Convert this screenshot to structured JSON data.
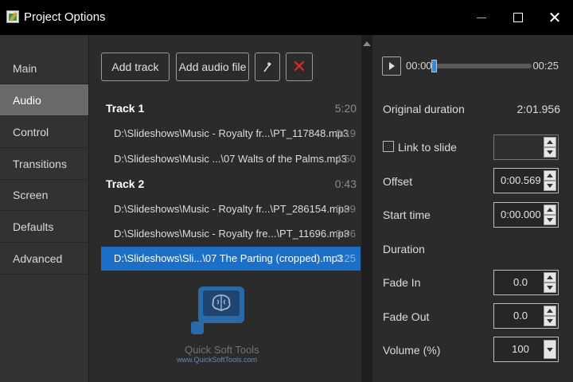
{
  "window": {
    "title": "Project Options",
    "minimize_icon": "minimize-icon",
    "maximize_icon": "maximize-icon",
    "close_glyph": "✕"
  },
  "sidebar": {
    "items": [
      {
        "label": "Main",
        "active": false
      },
      {
        "label": "Audio",
        "active": true
      },
      {
        "label": "Control",
        "active": false
      },
      {
        "label": "Transitions",
        "active": false
      },
      {
        "label": "Screen",
        "active": false
      },
      {
        "label": "Defaults",
        "active": false
      },
      {
        "label": "Advanced",
        "active": false
      }
    ]
  },
  "toolbar": {
    "add_track_label": "Add track",
    "add_audio_label": "Add audio file",
    "tool_icon": "wrench-icon",
    "delete_glyph": "✕"
  },
  "tracks": [
    {
      "name": "Track 1",
      "duration": "5:20",
      "files": [
        {
          "path": "D:\\Slideshows\\Music - Royalty fr...\\PT_117848.mp3",
          "duration": "0:19",
          "selected": false
        },
        {
          "path": "D:\\Slideshows\\Music ...\\07 Walts of the Palms.mp3",
          "duration": "4:50",
          "selected": false
        }
      ]
    },
    {
      "name": "Track 2",
      "duration": "0:43",
      "files": [
        {
          "path": "D:\\Slideshows\\Music - Royalty fr...\\PT_286154.mp3",
          "duration": "0:09",
          "selected": false
        },
        {
          "path": "D:\\Slideshows\\Music - Royalty fre...\\PT_11696.mp3",
          "duration": "0:06",
          "selected": false
        },
        {
          "path": "D:\\Slideshows\\Sli...\\07 The Parting (cropped).mp3",
          "duration": "0:25",
          "selected": true
        }
      ]
    }
  ],
  "player": {
    "current_time": "00:00",
    "end_time": "00:25",
    "progress": 0.0
  },
  "properties": {
    "original_duration_label": "Original duration",
    "original_duration_value": "2:01.956",
    "link_to_slide_label": "Link to slide",
    "link_to_slide_checked": false,
    "offset_label": "Offset",
    "offset_value": "0:00.569",
    "start_time_label": "Start time",
    "start_time_value": "0:00.000",
    "duration_label": "Duration",
    "fade_in_label": "Fade In",
    "fade_in_value": "0.0",
    "fade_out_label": "Fade Out",
    "fade_out_value": "0.0",
    "volume_label": "Volume (%)",
    "volume_value": "100"
  },
  "watermark": {
    "name": "Quick Soft Tools",
    "url": "www.QuickSoftTools.com"
  },
  "colors": {
    "selection": "#1c6fc7",
    "delete": "#e0282d",
    "seek_thumb": "#2f8ae0"
  }
}
